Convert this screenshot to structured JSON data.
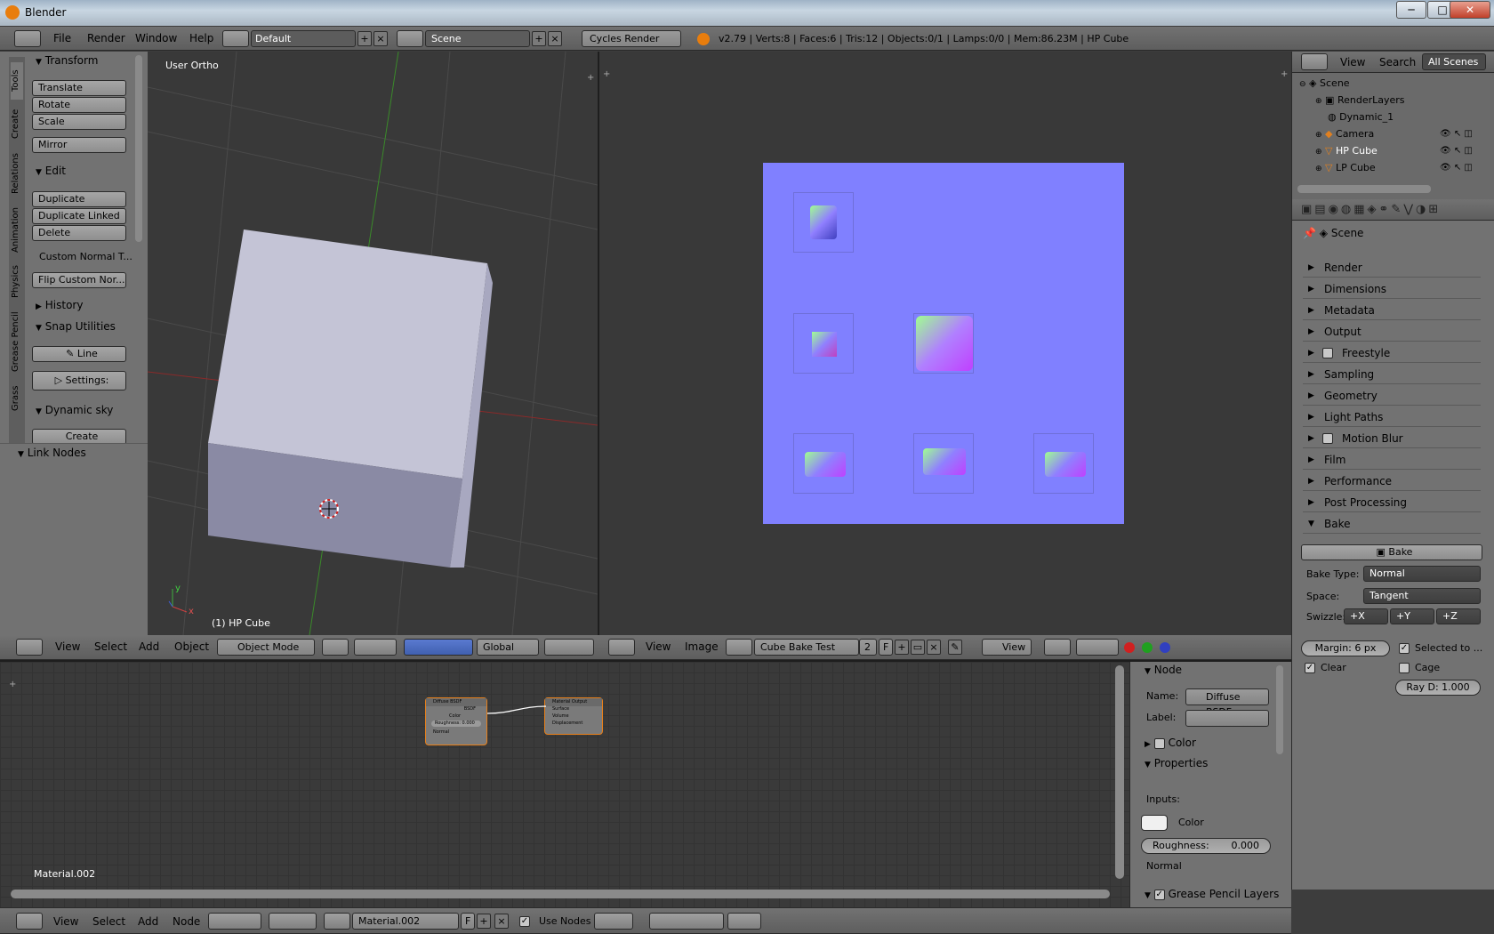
{
  "window": {
    "title": "Blender",
    "min": "─",
    "max": "□",
    "close": "✕"
  },
  "info_bar": {
    "menus": [
      "File",
      "Render",
      "Window",
      "Help"
    ],
    "layout": "Default",
    "scene": "Scene",
    "engine": "Cycles Render",
    "stats": "v2.79 | Verts:8 | Faces:6 | Tris:12 | Objects:0/1 | Lamps:0/0 | Mem:86.23M | HP Cube"
  },
  "tool_shelf": {
    "tabs": [
      "Tools",
      "Create",
      "Relations",
      "Animation",
      "Physics",
      "Grease Pencil",
      "Grass"
    ],
    "transform": {
      "title": "Transform",
      "buttons": [
        "Translate",
        "Rotate",
        "Scale",
        "Mirror"
      ]
    },
    "edit": {
      "title": "Edit",
      "buttons": [
        "Duplicate",
        "Duplicate Linked",
        "Delete"
      ],
      "custom_normal": "Custom Normal T...",
      "flip": "Flip Custom Nor..."
    },
    "history": "History",
    "snap": {
      "title": "Snap Utilities",
      "line": "Line",
      "settings": "Settings:"
    },
    "dynamic_sky": {
      "title": "Dynamic sky",
      "create": "Create"
    },
    "link_nodes": "Link Nodes"
  },
  "viewport3d": {
    "view_label": "User Ortho",
    "object_label": "(1) HP Cube",
    "axis_y": "y",
    "axis_x": "x",
    "header": {
      "menus": [
        "View",
        "Select",
        "Add",
        "Object"
      ],
      "mode": "Object Mode",
      "orientation": "Global"
    }
  },
  "image_editor": {
    "header": {
      "menus": [
        "View",
        "Image"
      ],
      "image_name": "Cube Bake Test",
      "users": "2",
      "fake": "F",
      "view": "View"
    }
  },
  "outliner": {
    "header": {
      "view": "View",
      "search": "Search",
      "filter": "All Scenes"
    },
    "items": [
      {
        "label": "Scene"
      },
      {
        "label": "RenderLayers"
      },
      {
        "label": "Dynamic_1"
      },
      {
        "label": "Camera"
      },
      {
        "label": "HP Cube"
      },
      {
        "label": "LP Cube"
      }
    ]
  },
  "properties": {
    "context": "Scene",
    "panels": [
      "Render",
      "Dimensions",
      "Metadata",
      "Output",
      "Freestyle",
      "Sampling",
      "Geometry",
      "Light Paths",
      "Motion Blur",
      "Film",
      "Performance",
      "Post Processing"
    ],
    "bake": {
      "title": "Bake",
      "button": "Bake",
      "bake_type_label": "Bake Type:",
      "bake_type": "Normal",
      "space_label": "Space:",
      "space": "Tangent",
      "swizzle_label": "Swizzle:",
      "swizzle": [
        "+X",
        "+Y",
        "+Z"
      ],
      "margin": "Margin:  6 px",
      "selected_to": "Selected to ...",
      "clear": "Clear",
      "cage": "Cage",
      "ray": "Ray D: 1.000"
    }
  },
  "node_editor": {
    "material_label": "Material.002",
    "diffuse_node": {
      "title": "Diffuse BSDF",
      "output": "BSDF",
      "color": "Color",
      "roughness": "Roughness: 0.000",
      "normal": "Normal"
    },
    "output_node": {
      "title": "Material Output",
      "surface": "Surface",
      "volume": "Volume",
      "displacement": "Displacement"
    },
    "header": {
      "menus": [
        "View",
        "Select",
        "Add",
        "Node"
      ],
      "material": "Material.002",
      "fake": "F",
      "use_nodes": "Use Nodes"
    }
  },
  "node_sidebar": {
    "node_title": "Node",
    "name_label": "Name:",
    "name_value": "Diffuse BSDF",
    "label_label": "Label:",
    "color": "Color",
    "properties": "Properties",
    "inputs": "Inputs:",
    "input_color": "Color",
    "roughness": "Roughness:",
    "roughness_value": "0.000",
    "normal": "Normal",
    "grease": "Grease Pencil Layers"
  }
}
